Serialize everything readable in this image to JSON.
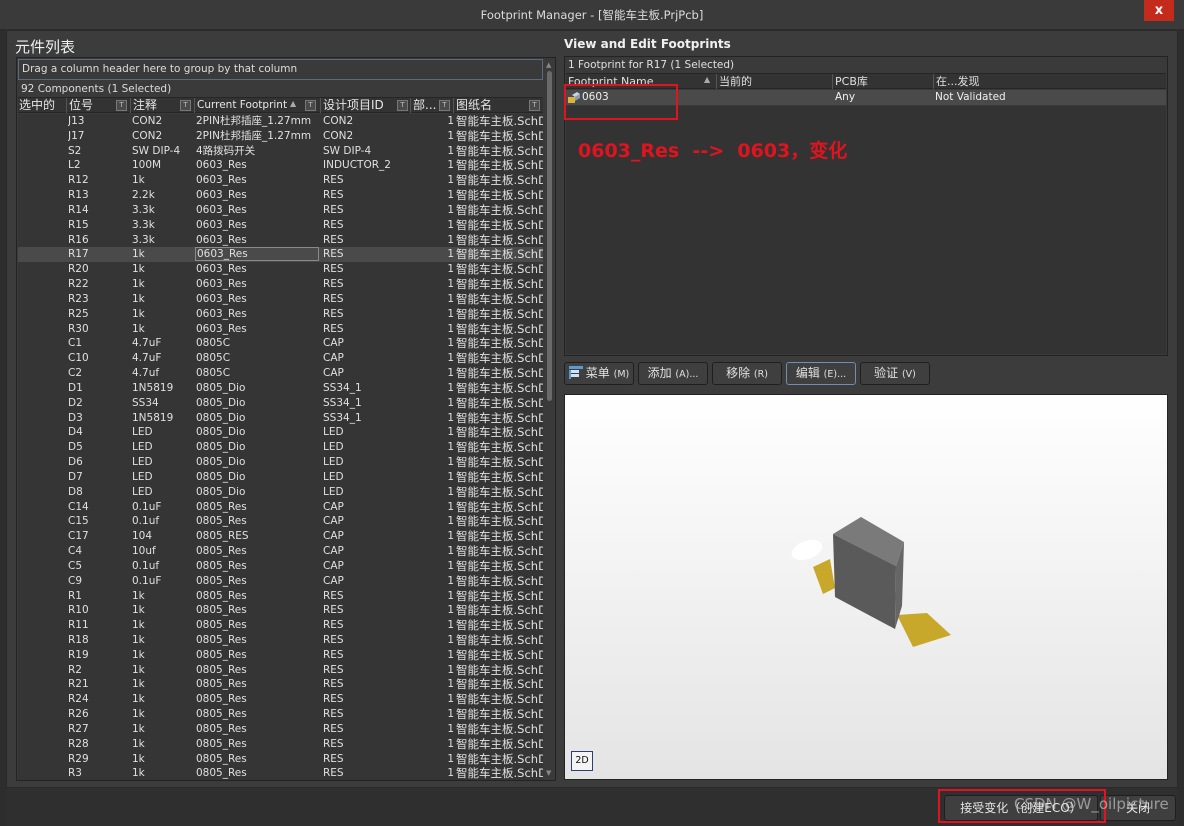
{
  "window": {
    "title": "Footprint Manager - [智能车主板.PrjPcb]",
    "close_label": "x"
  },
  "left": {
    "title": "元件列表",
    "group_hint": "Drag a column header here to group by that column",
    "count": "92 Components (1 Selected)",
    "columns": [
      "选中的",
      "位号",
      "注释",
      "Current Footprint",
      "设计项目ID",
      "部...",
      "图纸名"
    ],
    "sorted_column": "Current Footprint",
    "rows": [
      {
        "ref": "J13",
        "comment": "CON2",
        "footprint": "2PIN杜邦插座_1.27mm",
        "id": "CON2",
        "part": "1",
        "sheet": "智能车主板.SchD"
      },
      {
        "ref": "J17",
        "comment": "CON2",
        "footprint": "2PIN杜邦插座_1.27mm",
        "id": "CON2",
        "part": "1",
        "sheet": "智能车主板.SchD"
      },
      {
        "ref": "S2",
        "comment": "SW DIP-4",
        "footprint": "4路拨码开关",
        "id": "SW DIP-4",
        "part": "1",
        "sheet": "智能车主板.SchD"
      },
      {
        "ref": "L2",
        "comment": "100M",
        "footprint": "0603_Res",
        "id": "INDUCTOR_2",
        "part": "1",
        "sheet": "智能车主板.SchD"
      },
      {
        "ref": "R12",
        "comment": "1k",
        "footprint": "0603_Res",
        "id": "RES",
        "part": "1",
        "sheet": "智能车主板.SchD"
      },
      {
        "ref": "R13",
        "comment": "2.2k",
        "footprint": "0603_Res",
        "id": "RES",
        "part": "1",
        "sheet": "智能车主板.SchD"
      },
      {
        "ref": "R14",
        "comment": "3.3k",
        "footprint": "0603_Res",
        "id": "RES",
        "part": "1",
        "sheet": "智能车主板.SchD"
      },
      {
        "ref": "R15",
        "comment": "3.3k",
        "footprint": "0603_Res",
        "id": "RES",
        "part": "1",
        "sheet": "智能车主板.SchD"
      },
      {
        "ref": "R16",
        "comment": "3.3k",
        "footprint": "0603_Res",
        "id": "RES",
        "part": "1",
        "sheet": "智能车主板.SchD"
      },
      {
        "ref": "R17",
        "comment": "1k",
        "footprint": "0603_Res",
        "id": "RES",
        "part": "1",
        "sheet": "智能车主板.SchD",
        "selected": true
      },
      {
        "ref": "R20",
        "comment": "1k",
        "footprint": "0603_Res",
        "id": "RES",
        "part": "1",
        "sheet": "智能车主板.SchD"
      },
      {
        "ref": "R22",
        "comment": "1k",
        "footprint": "0603_Res",
        "id": "RES",
        "part": "1",
        "sheet": "智能车主板.SchD"
      },
      {
        "ref": "R23",
        "comment": "1k",
        "footprint": "0603_Res",
        "id": "RES",
        "part": "1",
        "sheet": "智能车主板.SchD"
      },
      {
        "ref": "R25",
        "comment": "1k",
        "footprint": "0603_Res",
        "id": "RES",
        "part": "1",
        "sheet": "智能车主板.SchD"
      },
      {
        "ref": "R30",
        "comment": "1k",
        "footprint": "0603_Res",
        "id": "RES",
        "part": "1",
        "sheet": "智能车主板.SchD"
      },
      {
        "ref": "C1",
        "comment": "4.7uF",
        "footprint": "0805C",
        "id": "CAP",
        "part": "1",
        "sheet": "智能车主板.SchD"
      },
      {
        "ref": "C10",
        "comment": "4.7uF",
        "footprint": "0805C",
        "id": "CAP",
        "part": "1",
        "sheet": "智能车主板.SchD"
      },
      {
        "ref": "C2",
        "comment": "4.7uf",
        "footprint": "0805C",
        "id": "CAP",
        "part": "1",
        "sheet": "智能车主板.SchD"
      },
      {
        "ref": "D1",
        "comment": "1N5819",
        "footprint": "0805_Dio",
        "id": "SS34_1",
        "part": "1",
        "sheet": "智能车主板.SchD"
      },
      {
        "ref": "D2",
        "comment": "SS34",
        "footprint": "0805_Dio",
        "id": "SS34_1",
        "part": "1",
        "sheet": "智能车主板.SchD"
      },
      {
        "ref": "D3",
        "comment": "1N5819",
        "footprint": "0805_Dio",
        "id": "SS34_1",
        "part": "1",
        "sheet": "智能车主板.SchD"
      },
      {
        "ref": "D4",
        "comment": "LED",
        "footprint": "0805_Dio",
        "id": "LED",
        "part": "1",
        "sheet": "智能车主板.SchD"
      },
      {
        "ref": "D5",
        "comment": "LED",
        "footprint": "0805_Dio",
        "id": "LED",
        "part": "1",
        "sheet": "智能车主板.SchD"
      },
      {
        "ref": "D6",
        "comment": "LED",
        "footprint": "0805_Dio",
        "id": "LED",
        "part": "1",
        "sheet": "智能车主板.SchD"
      },
      {
        "ref": "D7",
        "comment": "LED",
        "footprint": "0805_Dio",
        "id": "LED",
        "part": "1",
        "sheet": "智能车主板.SchD"
      },
      {
        "ref": "D8",
        "comment": "LED",
        "footprint": "0805_Dio",
        "id": "LED",
        "part": "1",
        "sheet": "智能车主板.SchD"
      },
      {
        "ref": "C14",
        "comment": "0.1uF",
        "footprint": "0805_Res",
        "id": "CAP",
        "part": "1",
        "sheet": "智能车主板.SchD"
      },
      {
        "ref": "C15",
        "comment": "0.1uf",
        "footprint": "0805_Res",
        "id": "CAP",
        "part": "1",
        "sheet": "智能车主板.SchD"
      },
      {
        "ref": "C17",
        "comment": "104",
        "footprint": "0805_RES",
        "id": "CAP",
        "part": "1",
        "sheet": "智能车主板.SchD"
      },
      {
        "ref": "C4",
        "comment": "10uf",
        "footprint": "0805_Res",
        "id": "CAP",
        "part": "1",
        "sheet": "智能车主板.SchD"
      },
      {
        "ref": "C5",
        "comment": "0.1uf",
        "footprint": "0805_Res",
        "id": "CAP",
        "part": "1",
        "sheet": "智能车主板.SchD"
      },
      {
        "ref": "C9",
        "comment": "0.1uF",
        "footprint": "0805_Res",
        "id": "CAP",
        "part": "1",
        "sheet": "智能车主板.SchD"
      },
      {
        "ref": "R1",
        "comment": "1k",
        "footprint": "0805_Res",
        "id": "RES",
        "part": "1",
        "sheet": "智能车主板.SchD"
      },
      {
        "ref": "R10",
        "comment": "1k",
        "footprint": "0805_Res",
        "id": "RES",
        "part": "1",
        "sheet": "智能车主板.SchD"
      },
      {
        "ref": "R11",
        "comment": "1k",
        "footprint": "0805_Res",
        "id": "RES",
        "part": "1",
        "sheet": "智能车主板.SchD"
      },
      {
        "ref": "R18",
        "comment": "1k",
        "footprint": "0805_Res",
        "id": "RES",
        "part": "1",
        "sheet": "智能车主板.SchD"
      },
      {
        "ref": "R19",
        "comment": "1k",
        "footprint": "0805_Res",
        "id": "RES",
        "part": "1",
        "sheet": "智能车主板.SchD"
      },
      {
        "ref": "R2",
        "comment": "1k",
        "footprint": "0805_Res",
        "id": "RES",
        "part": "1",
        "sheet": "智能车主板.SchD"
      },
      {
        "ref": "R21",
        "comment": "1k",
        "footprint": "0805_Res",
        "id": "RES",
        "part": "1",
        "sheet": "智能车主板.SchD"
      },
      {
        "ref": "R24",
        "comment": "1k",
        "footprint": "0805_Res",
        "id": "RES",
        "part": "1",
        "sheet": "智能车主板.SchD"
      },
      {
        "ref": "R26",
        "comment": "1k",
        "footprint": "0805_Res",
        "id": "RES",
        "part": "1",
        "sheet": "智能车主板.SchD"
      },
      {
        "ref": "R27",
        "comment": "1k",
        "footprint": "0805_Res",
        "id": "RES",
        "part": "1",
        "sheet": "智能车主板.SchD"
      },
      {
        "ref": "R28",
        "comment": "1k",
        "footprint": "0805_Res",
        "id": "RES",
        "part": "1",
        "sheet": "智能车主板.SchD"
      },
      {
        "ref": "R29",
        "comment": "1k",
        "footprint": "0805_Res",
        "id": "RES",
        "part": "1",
        "sheet": "智能车主板.SchD"
      },
      {
        "ref": "R3",
        "comment": "1k",
        "footprint": "0805_Res",
        "id": "RES",
        "part": "1",
        "sheet": "智能车主板.SchD"
      }
    ]
  },
  "right": {
    "title": "View and Edit Footprints",
    "count": "1 Footprint for R17 (1 Selected)",
    "columns": [
      "Footprint Name",
      "当前的",
      "PCB库",
      "在...发现"
    ],
    "rows": [
      {
        "name": "0603",
        "current": "",
        "pcb_lib": "Any",
        "found_in": "Not Validated"
      }
    ],
    "annotation": "0603_Res  -->  0603，变化",
    "buttons": {
      "menu": {
        "label": "菜单",
        "accel": "(M)"
      },
      "add": {
        "label": "添加",
        "accel": "(A)..."
      },
      "remove": {
        "label": "移除",
        "accel": "(R)"
      },
      "edit": {
        "label": "编辑",
        "accel": "(E)..."
      },
      "validate": {
        "label": "验证",
        "accel": "(V)"
      }
    },
    "view_mode": "2D"
  },
  "footer": {
    "accept_label": "接受变化（创建ECO）",
    "close_label": "关闭",
    "watermark": "CSDN @W_oilpicture"
  },
  "colors": {
    "annotation_red": "#e0141e",
    "close_red": "#c42b1c",
    "pad_gold": "#c8a82a",
    "body_gray": "#6e6e6e"
  }
}
